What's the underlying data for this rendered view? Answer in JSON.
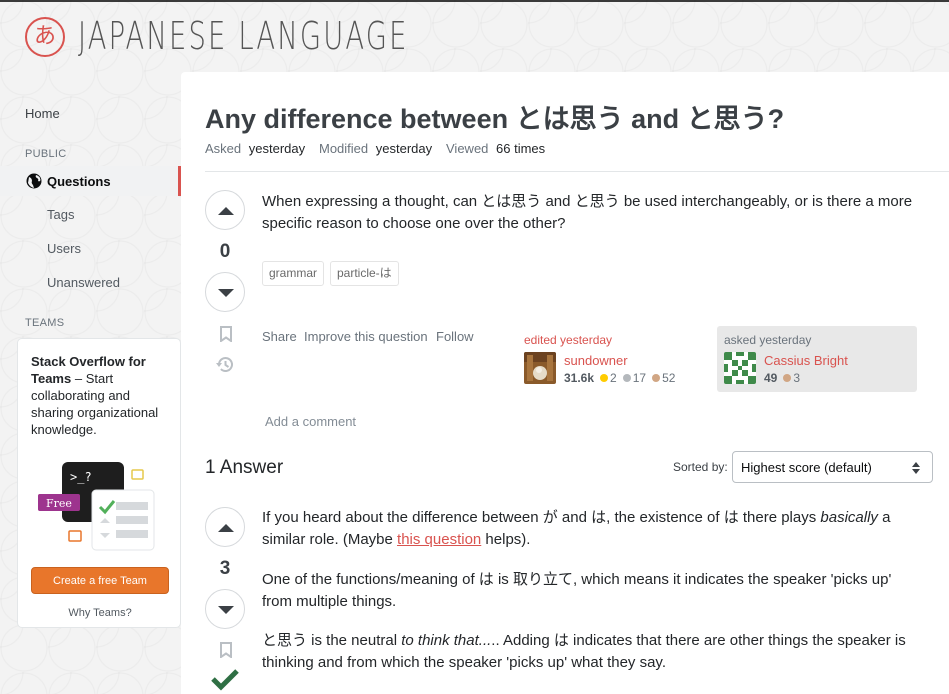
{
  "site": {
    "logo_glyph": "あ",
    "name": "Japanese Language",
    "accent": "#d9534f"
  },
  "nav": {
    "home": "Home",
    "public_heading": "PUBLIC",
    "questions": "Questions",
    "tags": "Tags",
    "users": "Users",
    "unanswered": "Unanswered",
    "teams_heading": "TEAMS"
  },
  "teams_promo": {
    "title_bold": "Stack Overflow for Teams",
    "title_rest": " – Start collaborating and sharing organizational knowledge.",
    "free_badge": "Free",
    "terminal_prompt": ">_?",
    "cta": "Create a free Team",
    "why": "Why Teams?"
  },
  "question": {
    "title": "Any difference between とは思う and と思う?",
    "meta": {
      "asked_label": "Asked",
      "asked_value": "yesterday",
      "modified_label": "Modified",
      "modified_value": "yesterday",
      "viewed_label": "Viewed",
      "viewed_value": "66 times"
    },
    "score": "0",
    "body": "When expressing a thought, can とは思う and と思う be used interchangeably, or is there a more specific reason to choose one over the other?",
    "tags": [
      "grammar",
      "particle-は"
    ],
    "menu": {
      "share": "Share",
      "improve": "Improve this question",
      "follow": "Follow"
    },
    "editor": {
      "action": "edited yesterday",
      "name": "sundowner",
      "reputation": "31.6k",
      "gold": "2",
      "silver": "17",
      "bronze": "52"
    },
    "owner": {
      "action": "asked yesterday",
      "name": "Cassius Bright",
      "reputation": "49",
      "bronze": "3"
    },
    "add_comment": "Add a comment"
  },
  "answers": {
    "heading": "1 Answer",
    "sorted_label": "Sorted by:",
    "sort_value": "Highest score (default)",
    "top": {
      "score": "3",
      "p1_a": "If you heard about the difference between が and は, the existence of は there plays ",
      "p1_em": "basically",
      "p1_b": " a similar role. (Maybe ",
      "p1_link": "this question",
      "p1_c": " helps).",
      "p2": "One of the functions/meaning of は is 取り立て, which means it indicates the speaker 'picks up' from multiple things.",
      "p3_a": "と思う is the neutral ",
      "p3_em": "to think that...",
      "p3_b": ".. Adding は indicates that there are other things the speaker is thinking and from which the speaker 'picks up' what they say."
    }
  },
  "colors": {
    "accepted": "#2f6f44",
    "gold": "#ffcc01",
    "silver": "#b4b8bc",
    "bronze": "#d1a684",
    "cta": "#e8762b"
  }
}
